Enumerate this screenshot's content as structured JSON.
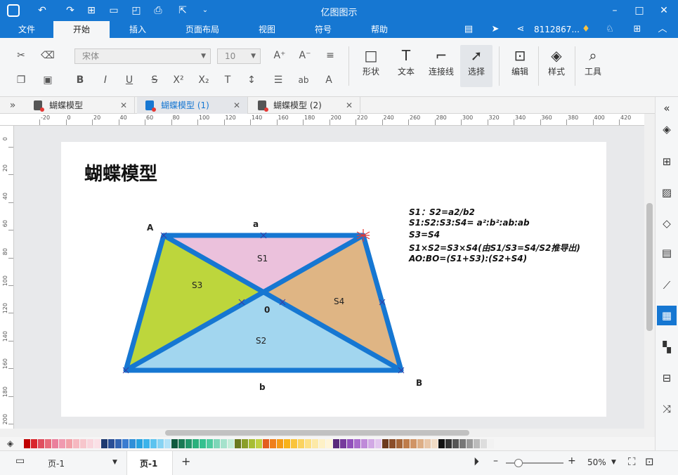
{
  "window": {
    "title": "亿图图示"
  },
  "menu": {
    "tabs": [
      {
        "label": "文件"
      },
      {
        "label": "开始"
      },
      {
        "label": "插入"
      },
      {
        "label": "页面布局"
      },
      {
        "label": "视图"
      },
      {
        "label": "符号"
      },
      {
        "label": "帮助"
      }
    ],
    "user": "8112867..."
  },
  "ribbon": {
    "font_name": "宋体",
    "font_size": "10",
    "tools": [
      {
        "label": "形状"
      },
      {
        "label": "文本"
      },
      {
        "label": "连接线"
      },
      {
        "label": "选择"
      },
      {
        "label": "编辑"
      },
      {
        "label": "样式"
      },
      {
        "label": "工具"
      }
    ]
  },
  "doc_tabs": [
    {
      "label": "蝴蝶模型"
    },
    {
      "label": "蝴蝶模型 (1)"
    },
    {
      "label": "蝴蝶模型 (2)"
    }
  ],
  "ruler": {
    "h_labels": [
      "-20",
      "0",
      "20",
      "40",
      "60",
      "80",
      "100",
      "120",
      "140",
      "160",
      "180",
      "200",
      "220",
      "240",
      "260",
      "280",
      "300",
      "320",
      "340",
      "360",
      "380",
      "400",
      "420"
    ],
    "v_labels": [
      "0",
      "20",
      "40",
      "60",
      "80",
      "100",
      "120",
      "140",
      "160",
      "180",
      "200"
    ]
  },
  "diagram": {
    "title": "蝴蝶模型",
    "labels": {
      "A": "A",
      "B": "B",
      "a": "a",
      "b": "b",
      "O": "0",
      "S1": "S1",
      "S2": "S2",
      "S3": "S3",
      "S4": "S4"
    },
    "formulas": [
      "S1：S2=a2/b2",
      "S1:S2:S3:S4= a²:b²:ab:ab",
      "S3=S4",
      "S1×S2=S3×S4(由S1/S3=S4/S2推导出)",
      "AO:BO=(S1+S3):(S2+S4)"
    ],
    "colors": {
      "border": "#1677d2",
      "S1": "#ebc1dc",
      "S2": "#a2d6ef",
      "S3": "#bdd63c",
      "S4": "#dfb584"
    }
  },
  "status": {
    "page_select": "页-1",
    "page_tab": "页-1",
    "zoom": "50%"
  }
}
